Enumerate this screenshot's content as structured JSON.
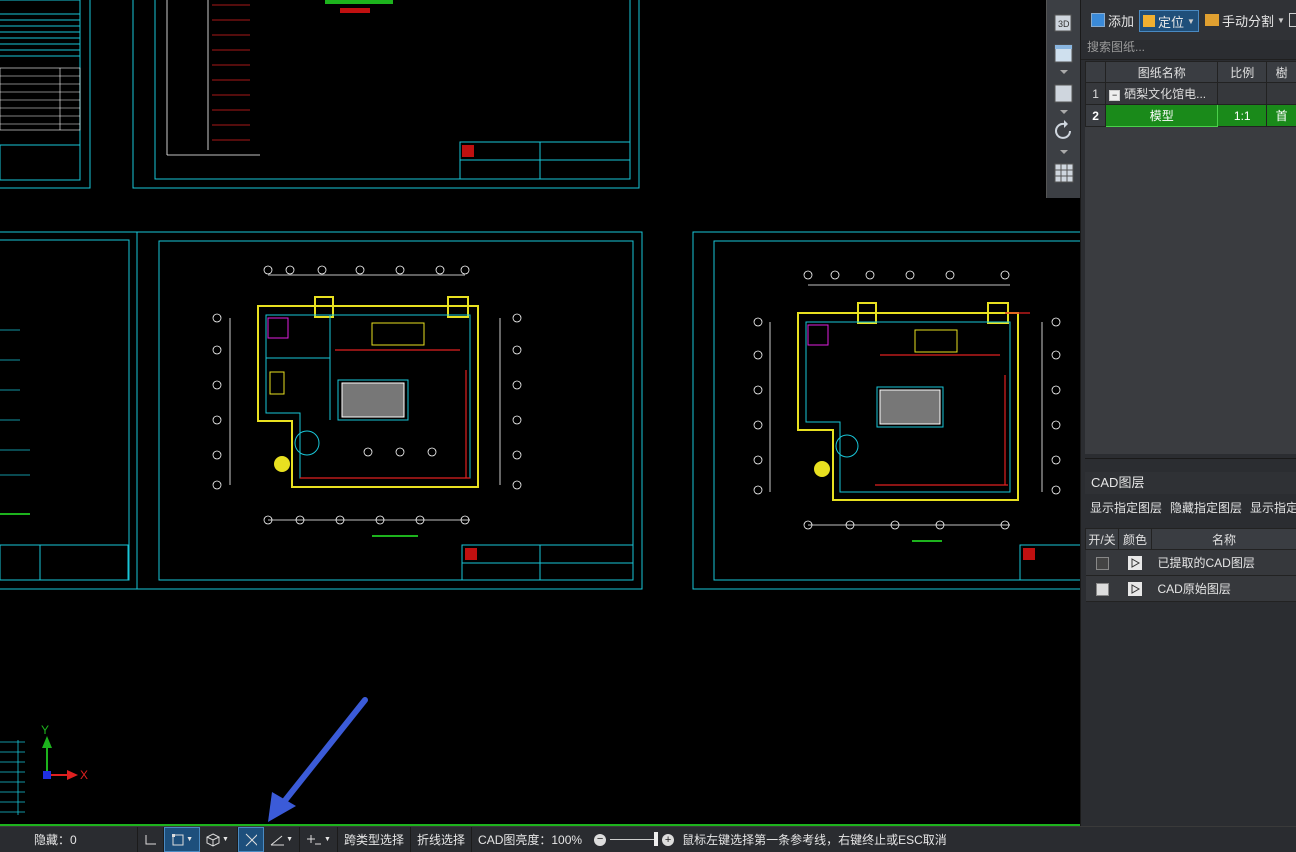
{
  "toolbar": {
    "add_label": "添加",
    "locate_label": "定位",
    "manual_split_label": "手动分割"
  },
  "search": {
    "placeholder": "搜索图纸..."
  },
  "sheet_table": {
    "headers": [
      "",
      "图纸名称",
      "比例",
      "樹"
    ],
    "rows": [
      {
        "index": "1",
        "name": "硒梨文化馆电...",
        "scale": "",
        "extra": ""
      },
      {
        "index": "2",
        "name": "模型",
        "scale": "1:1",
        "extra": "首"
      }
    ]
  },
  "layers": {
    "title": "CAD图层",
    "actions": [
      "显示指定图层",
      "隐藏指定图层",
      "显示指定"
    ],
    "headers": [
      "开/关",
      "颜色",
      "名称"
    ],
    "rows": [
      {
        "name": "已提取的CAD图层"
      },
      {
        "name": "CAD原始图层"
      }
    ]
  },
  "statusbar": {
    "hidden_label": "隐藏：0",
    "cross_type_select": "跨类型选择",
    "polyline_select": "折线选择",
    "brightness": "CAD图亮度：100%",
    "hint": "鼠标左键选择第一条参考线，右键终止或ESC取消"
  },
  "axis": {
    "x": "X",
    "y": "Y"
  },
  "colors": {
    "accent": "#1f4f7a",
    "cad_cyan": "#19c6d8",
    "cad_yellow": "#e8e020",
    "cad_red": "#e02020",
    "cad_magenta": "#e020e0",
    "selected_row": "#1a8a1a",
    "arrow": "#3b5bd8"
  }
}
